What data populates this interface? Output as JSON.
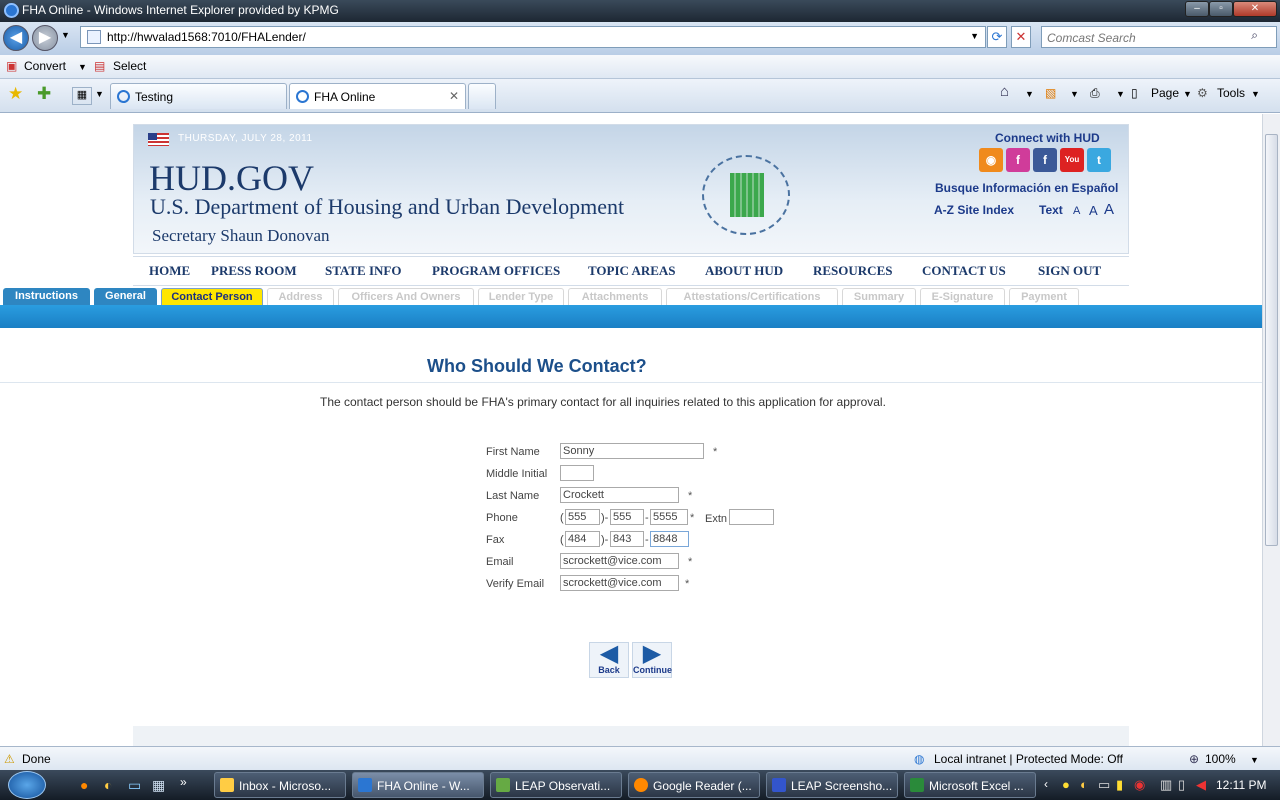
{
  "window": {
    "title": "FHA Online - Windows Internet Explorer provided by KPMG"
  },
  "address": {
    "url": "http://hwvalad1568:7010/FHALender/",
    "search_placeholder": "Comcast Search"
  },
  "links": {
    "convert": "Convert",
    "select": "Select"
  },
  "browser_tabs": [
    {
      "label": "Testing"
    },
    {
      "label": "FHA Online"
    }
  ],
  "commands": {
    "page": "Page",
    "tools": "Tools"
  },
  "banner": {
    "date": "THURSDAY, JULY 28, 2011",
    "site": "HUD.GOV",
    "department": "U.S. Department of Housing and Urban Development",
    "secretary": "Secretary Shaun Donovan",
    "connect": "Connect with HUD",
    "espanol": "Busque Información en Español",
    "az_index": "A-Z Site Index",
    "text_label": "Text",
    "text_sizes": [
      "A",
      "A",
      "A"
    ]
  },
  "main_nav": [
    "HOME",
    "PRESS ROOM",
    "STATE INFO",
    "PROGRAM OFFICES",
    "TOPIC AREAS",
    "ABOUT HUD",
    "RESOURCES",
    "CONTACT US",
    "SIGN OUT"
  ],
  "steps": [
    {
      "label": "Instructions",
      "state": "done"
    },
    {
      "label": "General",
      "state": "done"
    },
    {
      "label": "Contact Person",
      "state": "current"
    },
    {
      "label": "Address",
      "state": "disabled"
    },
    {
      "label": "Officers And Owners",
      "state": "disabled"
    },
    {
      "label": "Lender Type",
      "state": "disabled"
    },
    {
      "label": "Attachments",
      "state": "disabled"
    },
    {
      "label": "Attestations/Certifications",
      "state": "disabled"
    },
    {
      "label": "Summary",
      "state": "disabled"
    },
    {
      "label": "E-Signature",
      "state": "disabled"
    },
    {
      "label": "Payment",
      "state": "disabled"
    }
  ],
  "form": {
    "title": "Who Should We Contact?",
    "intro": "The contact person should be FHA's primary contact for all inquiries related to this application for approval.",
    "labels": {
      "first": "First Name",
      "middle": "Middle Initial",
      "last": "Last Name",
      "phone": "Phone",
      "fax": "Fax",
      "email": "Email",
      "verify": "Verify Email",
      "extn": "Extn"
    },
    "values": {
      "first": "Sonny",
      "middle": "",
      "last": "Crockett",
      "phone1": "555",
      "phone2": "555",
      "phone3": "5555",
      "extn": "",
      "fax1": "484",
      "fax2": "843",
      "fax3": "8848",
      "email": "scrockett@vice.com",
      "verify": "scrockett@vice.com"
    },
    "required_mark": "*",
    "back": "Back",
    "continue": "Continue"
  },
  "status": {
    "text": "Done",
    "zone": "Local intranet | Protected Mode: Off",
    "zoom": "100%"
  },
  "taskbar": {
    "tasks": [
      "Inbox - Microso...",
      "FHA Online - W...",
      "LEAP Observati...",
      "Google Reader (...",
      "LEAP Screensho...",
      "Microsoft Excel ..."
    ],
    "clock": "12:11 PM"
  }
}
